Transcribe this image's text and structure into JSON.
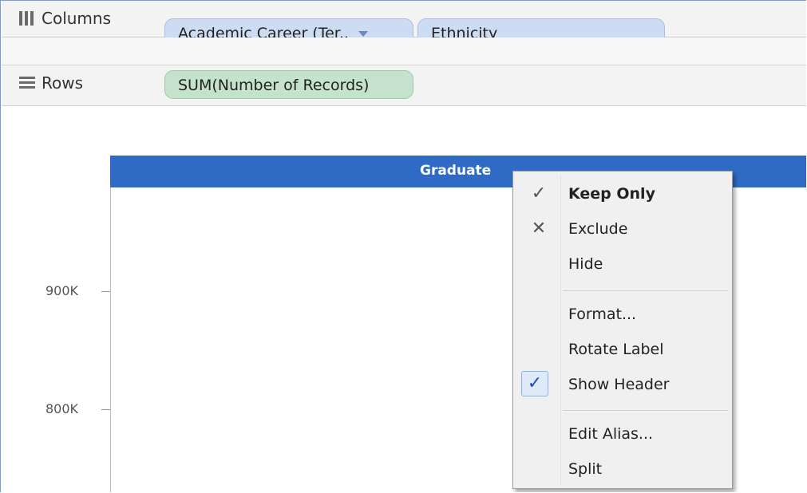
{
  "shelves": {
    "columns": {
      "label": "Columns",
      "pills": [
        {
          "text": "Academic Career (Ter..",
          "has_dropdown": true
        },
        {
          "text": "Ethnicity"
        }
      ]
    },
    "rows": {
      "label": "Rows",
      "pills": [
        {
          "text": "SUM(Number of Records)"
        }
      ]
    }
  },
  "chart": {
    "header_label": "Graduate",
    "y_ticks": [
      "900K",
      "800K"
    ],
    "header_color": "#2f6bc4"
  },
  "context_menu": {
    "items": [
      {
        "label": "Keep Only",
        "mark": "✓",
        "bold": true
      },
      {
        "label": "Exclude",
        "mark": "✕"
      },
      {
        "label": "Hide"
      },
      {
        "label": "Format..."
      },
      {
        "label": "Rotate Label"
      },
      {
        "label": "Show Header",
        "checked": true,
        "mark": "✓"
      },
      {
        "label": "Edit Alias..."
      },
      {
        "label": "Split"
      }
    ]
  },
  "icons": {
    "columns_shelf": "columns-icon",
    "rows_shelf": "rows-icon"
  }
}
